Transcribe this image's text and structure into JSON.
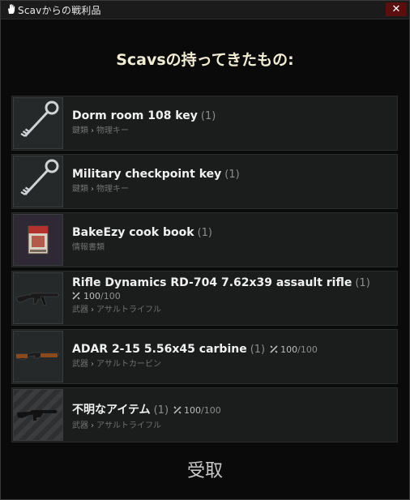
{
  "window": {
    "title": "Scavからの戦利品",
    "close_symbol": "✕"
  },
  "heading": "Scavsの持ってきたもの:",
  "items": [
    {
      "name": "Dorm room 108 key",
      "count": "(1)",
      "category": "鍵類",
      "subcategory": "物理キー",
      "icon": "key-icon"
    },
    {
      "name": "Military checkpoint key",
      "count": "(1)",
      "category": "鍵類",
      "subcategory": "物理キー",
      "icon": "key-icon"
    },
    {
      "name": "BakeEzy cook book",
      "count": "(1)",
      "category": "情報書類",
      "subcategory": "",
      "icon": "book-icon"
    },
    {
      "name": "Rifle Dynamics RD-704 7.62x39 assault rifle",
      "count": "(1)",
      "durability": "100",
      "durability_max": "/100",
      "category": "武器",
      "subcategory": "アサルトライフル",
      "icon": "rifle-icon"
    },
    {
      "name": "ADAR 2-15 5.56x45 carbine",
      "count": "(1)",
      "durability": "100",
      "durability_max": "/100",
      "category": "武器",
      "subcategory": "アサルトカービン",
      "icon": "carbine-icon"
    },
    {
      "name": "不明なアイテム",
      "count": "(1)",
      "durability": "100",
      "durability_max": "/100",
      "category": "武器",
      "subcategory": "アサルトライフル",
      "icon": "unknown-rifle-icon"
    }
  ],
  "category_separator": "›",
  "take_button": "受取",
  "colors": {
    "close_bg": "#5a0f0f",
    "heading": "#f1ecd4",
    "row_bg": "#1b1d1c"
  }
}
